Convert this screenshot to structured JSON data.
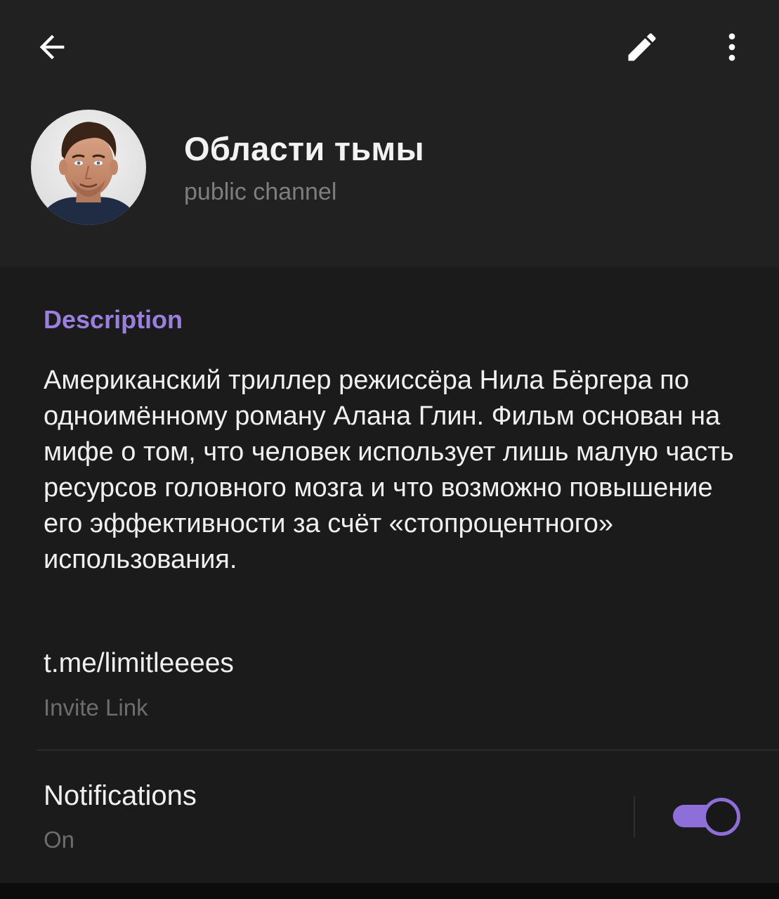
{
  "colors": {
    "accent": "#8e6fd9",
    "section_header": "#9b7fe0",
    "header_bg": "#212121",
    "body_bg": "#1b1b1b",
    "text_primary": "#f0f0f0",
    "text_secondary": "#6d6d6d"
  },
  "toolbar": {
    "back_icon": "arrow-left-icon",
    "edit_icon": "pencil-icon",
    "more_icon": "more-vertical-icon"
  },
  "channel": {
    "title": "Области тьмы",
    "subtitle": "public channel",
    "avatar_icon": "avatar-photo"
  },
  "description": {
    "header": "Description",
    "text": "Американский триллер режиссёра Нила Бёргера по одноимённому роману Алана Глин. Фильм основан на мифе о том, что человек использует лишь малую часть ресурсов головного мозга и что возможно повышение его эффективности за счёт «стопроцентного» использования."
  },
  "invite": {
    "link": "t.me/limitleeees",
    "caption": "Invite Link"
  },
  "notifications": {
    "title": "Notifications",
    "status": "On",
    "enabled": true
  }
}
